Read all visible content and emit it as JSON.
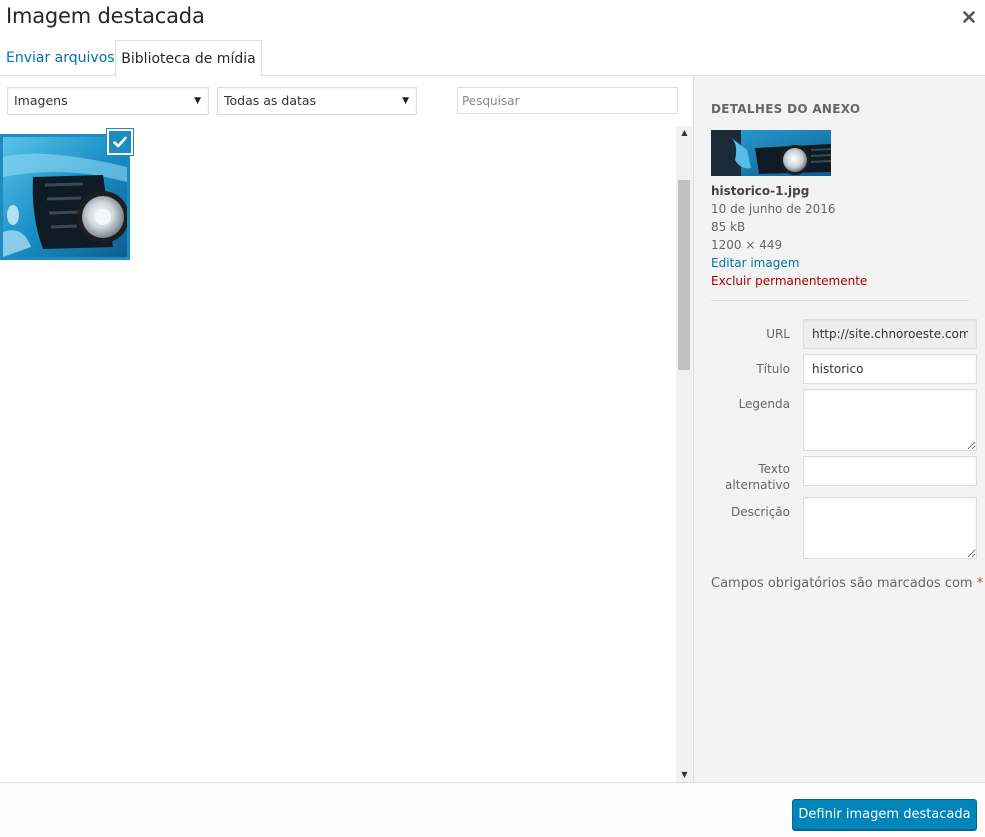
{
  "modal": {
    "title": "Imagem destacada",
    "close_icon": "close-icon"
  },
  "tabs": [
    {
      "label": "Enviar arquivos",
      "active": false
    },
    {
      "label": "Biblioteca de mídia",
      "active": true
    }
  ],
  "filters": {
    "type_selected": "Imagens",
    "date_selected": "Todas as datas",
    "search_placeholder": "Pesquisar"
  },
  "attachment": {
    "selected": true,
    "check_icon": "checkmark-icon"
  },
  "details": {
    "heading": "DETALHES DO ANEXO",
    "filename": "historico-1.jpg",
    "date": "10 de junho de 2016",
    "size": "85 kB",
    "dimensions": "1200 × 449",
    "edit_link": "Editar imagem",
    "delete_link": "Excluir permanentemente"
  },
  "fields": {
    "url": {
      "label": "URL",
      "value": "http://site.chnoroeste.com.br"
    },
    "title": {
      "label": "Título",
      "value": "historico"
    },
    "caption": {
      "label": "Legenda",
      "value": ""
    },
    "alt_line1": "Texto",
    "alt_line2": "alternativo",
    "alt": {
      "value": ""
    },
    "description": {
      "label": "Descrição",
      "value": ""
    }
  },
  "required_note": {
    "text": "Campos obrigatórios são marcados com",
    "star": "*"
  },
  "footer": {
    "primary_button": "Definir imagem destacada"
  },
  "colors": {
    "accent": "#0085ba",
    "link": "#0073aa",
    "danger": "#aa0000",
    "selection_border": "#1e8cbe"
  }
}
